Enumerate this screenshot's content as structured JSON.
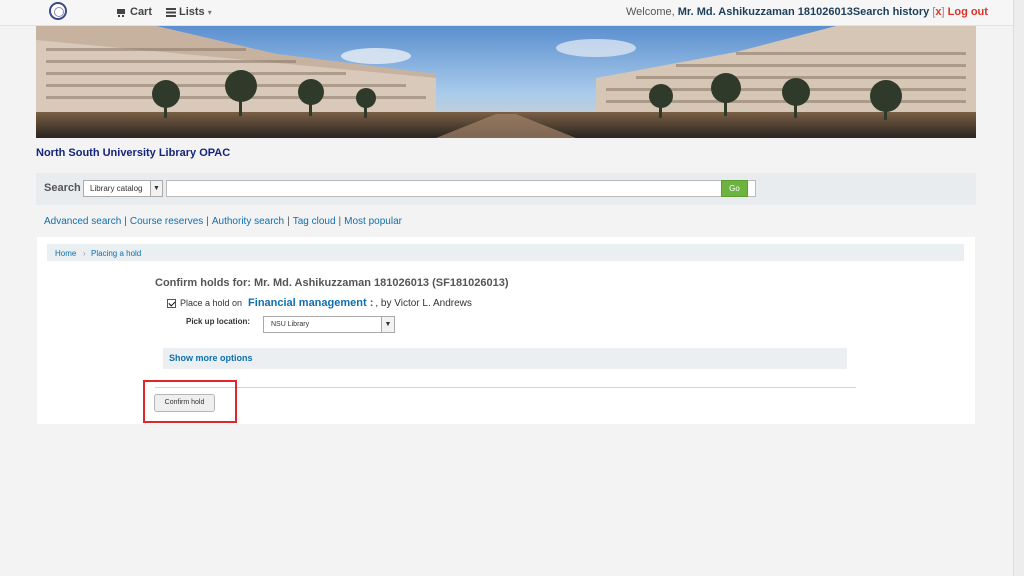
{
  "header": {
    "cart_label": "Cart",
    "lists_label": "Lists",
    "welcome_prefix": "Welcome,",
    "user_name": "Mr. Md. Ashikuzzaman 181026013",
    "search_history": "Search history",
    "bracket_open": "[",
    "clear_x": "x",
    "bracket_close": "]",
    "logout": "Log out"
  },
  "site": {
    "title": "North South University Library OPAC"
  },
  "search": {
    "label": "Search",
    "scope": "Library catalog",
    "query": "",
    "go_label": "Go"
  },
  "nav": {
    "links": [
      "Advanced search",
      "Course reserves",
      "Authority search",
      "Tag cloud",
      "Most popular"
    ]
  },
  "breadcrumb": {
    "home": "Home",
    "current": "Placing a hold",
    "separator": "›"
  },
  "hold": {
    "heading": "Confirm holds for: Mr. Md. Ashikuzzaman 181026013 (SF181026013)",
    "place_label": "Place a hold on",
    "title": "Financial management :",
    "rest": ", by Victor L. Andrews",
    "pickup_label": "Pick up location:",
    "pickup_value": "NSU Library",
    "more_options": "Show more options",
    "confirm_label": "Confirm hold"
  },
  "colors": {
    "link": "#0e6fae",
    "site_title": "#14247a",
    "go_button": "#6cb33f",
    "logout": "#d9342b",
    "highlight": "#e2252b"
  }
}
